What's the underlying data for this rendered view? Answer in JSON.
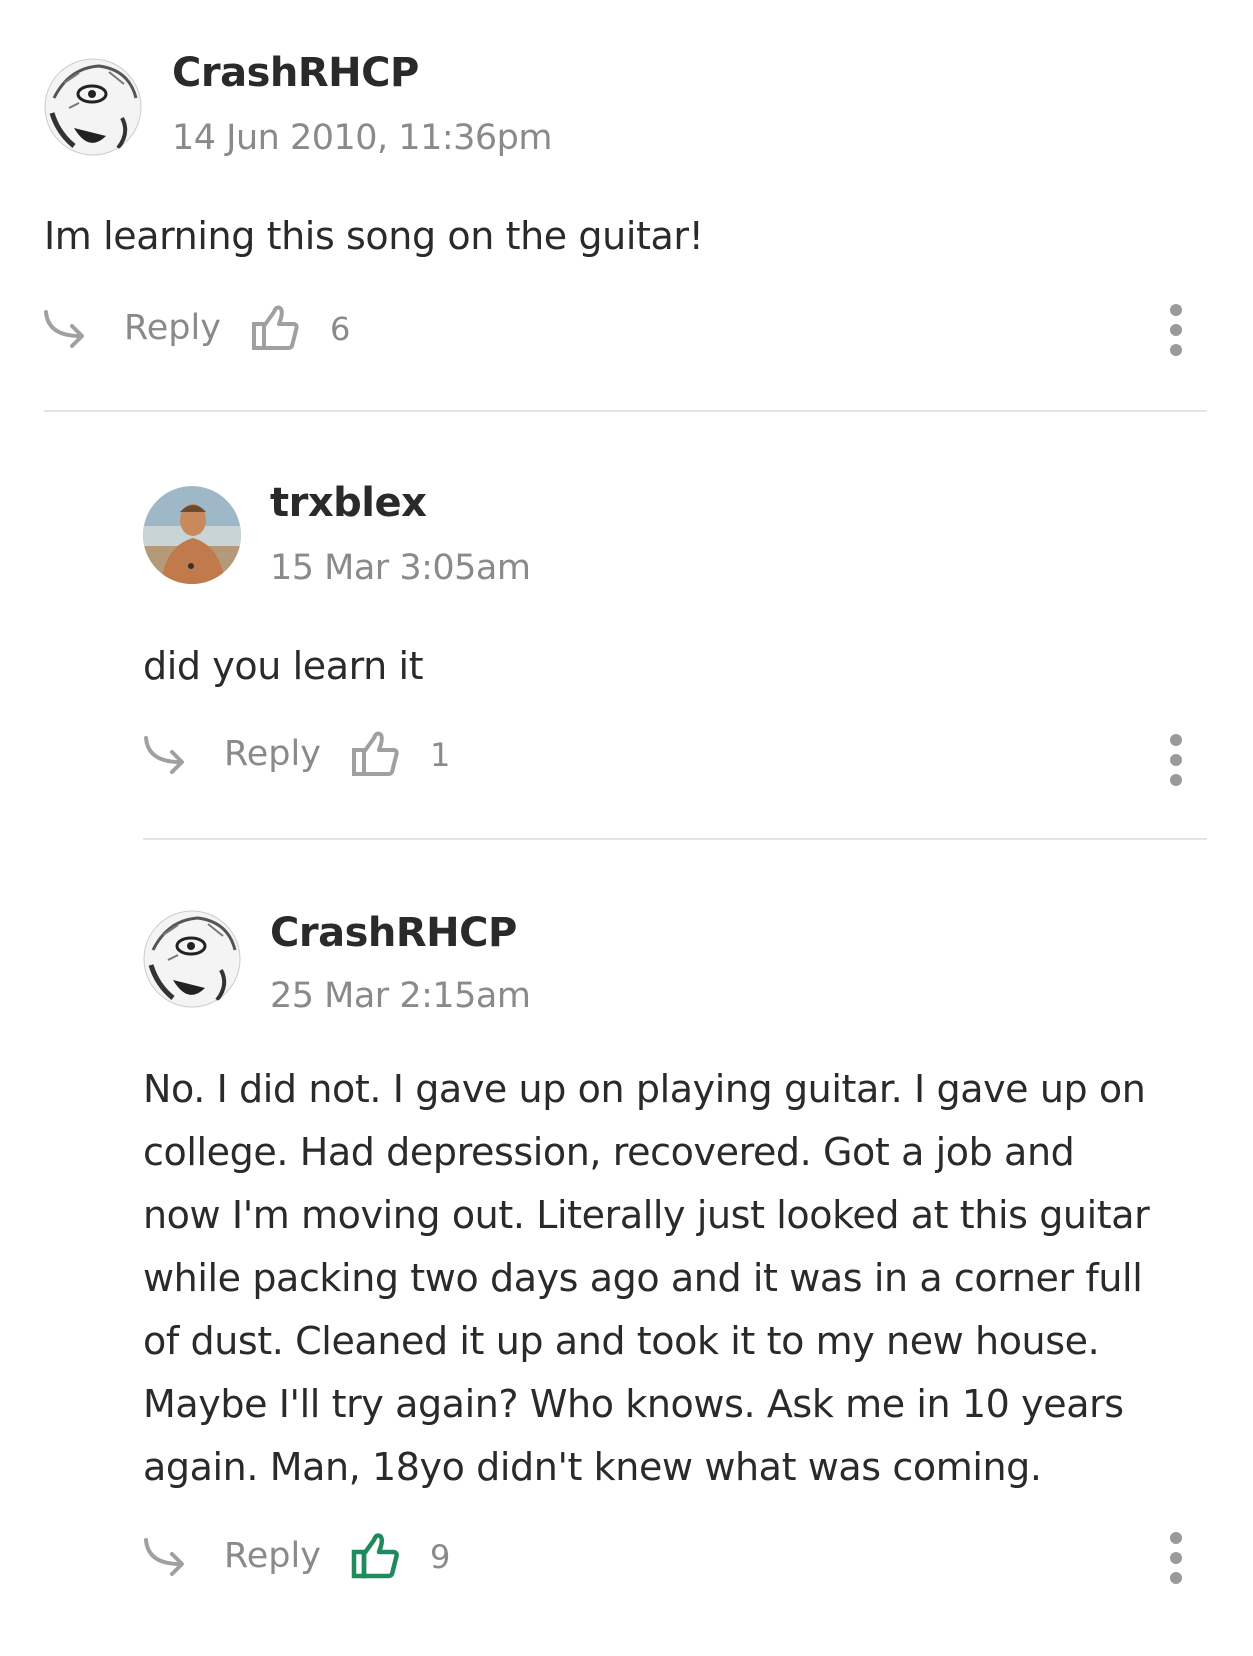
{
  "comments": [
    {
      "username": "CrashRHCP",
      "timestamp": "14 Jun 2010, 11:36pm",
      "body": "Im learning this song on the guitar!",
      "reply_label": "Reply",
      "likes": "6",
      "liked": false
    },
    {
      "username": "trxblex",
      "timestamp": "15 Mar 3:05am",
      "body": "did you learn it",
      "reply_label": "Reply",
      "likes": "1",
      "liked": false
    },
    {
      "username": "CrashRHCP",
      "timestamp": "25 Mar 2:15am",
      "body_lines": [
        "No. I did not. I gave up on playing guitar. I gave up on",
        "college. Had depression, recovered. Got a job and",
        "now I'm moving out. Literally just looked at this guitar",
        "while packing two days ago and it was in a corner full",
        "of dust. Cleaned it up and took it to my new house.",
        "Maybe I'll try again? Who knows. Ask me in 10 years",
        "again. Man, 18yo didn't knew what was coming."
      ],
      "reply_label": "Reply",
      "likes": "9",
      "liked": true
    }
  ],
  "colors": {
    "liked": "#1f8a5b",
    "icon_gray": "#a0a0a0"
  }
}
